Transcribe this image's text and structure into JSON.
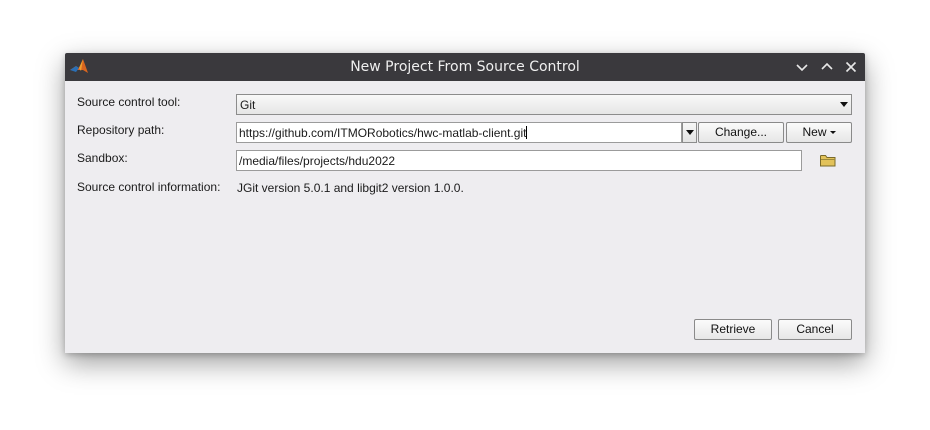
{
  "window": {
    "title": "New Project From Source Control",
    "icon": "matlab-logo-icon",
    "controls": [
      "minimize-icon",
      "maximize-icon",
      "close-icon"
    ]
  },
  "form": {
    "source_tool": {
      "label": "Source control tool:",
      "value": "Git"
    },
    "repository": {
      "label": "Repository path:",
      "value": "https://github.com/ITMORobotics/hwc-matlab-client.git",
      "change_label": "Change...",
      "new_label": "New"
    },
    "sandbox": {
      "label": "Sandbox:",
      "value": "/media/files/projects/hdu2022",
      "icon": "folder-icon"
    },
    "info": {
      "label": "Source control information:",
      "value": "JGit version 5.0.1 and libgit2 version 1.0.0."
    }
  },
  "actions": {
    "retrieve_label": "Retrieve",
    "cancel_label": "Cancel"
  },
  "colors": {
    "titlebar": "#3a393d",
    "dialog_bg": "#eeedf0",
    "folder": "#e2c25a"
  }
}
